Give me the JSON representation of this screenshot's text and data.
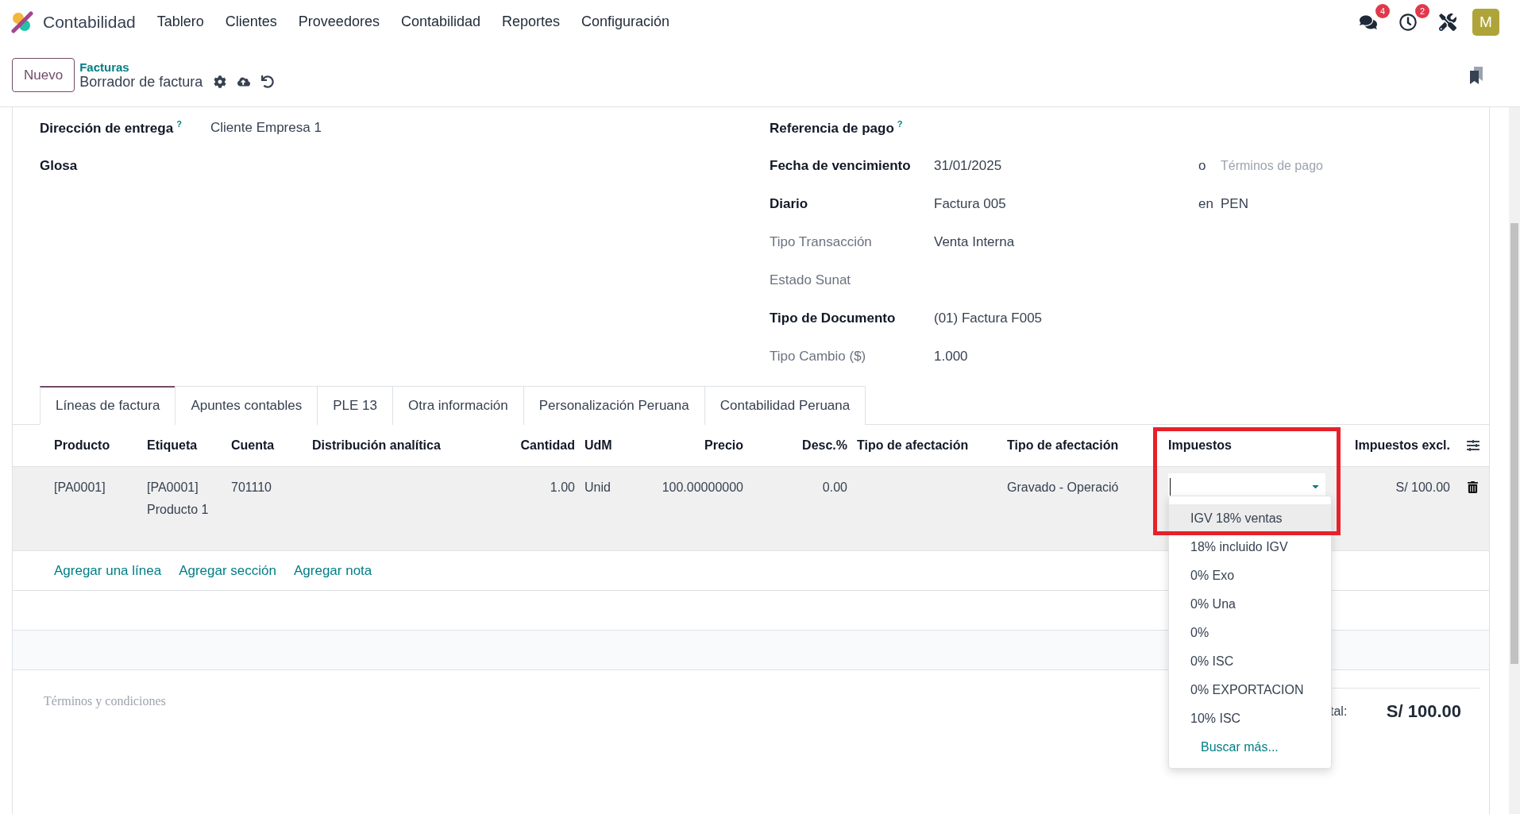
{
  "navbar": {
    "app_name": "Contabilidad",
    "menu": [
      {
        "label": "Tablero"
      },
      {
        "label": "Clientes"
      },
      {
        "label": "Proveedores"
      },
      {
        "label": "Contabilidad"
      },
      {
        "label": "Reportes"
      },
      {
        "label": "Configuración"
      }
    ],
    "messages_badge": "4",
    "activities_badge": "2",
    "avatar": "M"
  },
  "control_panel": {
    "new_button": "Nuevo",
    "breadcrumb": "Facturas",
    "record_title": "Borrador de factura"
  },
  "form": {
    "left_fields": [
      {
        "label": "Dirección de entrega",
        "help": "?",
        "emphasis": true,
        "value": "Cliente Empresa 1"
      },
      {
        "label": "Glosa",
        "emphasis": true
      }
    ],
    "right_fields": [
      {
        "label": "Referencia de pago",
        "help": "?",
        "emphasis": true
      },
      {
        "label": "Fecha de vencimiento",
        "emphasis": true,
        "value": "31/01/2025",
        "extra": {
          "connector": "o",
          "placeholder": "Términos de pago"
        }
      },
      {
        "label": "Diario",
        "emphasis": true,
        "value": "Factura 005",
        "extra": {
          "connector": "en",
          "value": "PEN"
        }
      },
      {
        "label": "Tipo Transacción",
        "emphasis": false,
        "value": "Venta Interna"
      },
      {
        "label": "Estado Sunat",
        "emphasis": false
      },
      {
        "label": "Tipo de Documento",
        "emphasis": true,
        "value": "(01) Factura F005"
      },
      {
        "label": "Tipo Cambio ($)",
        "emphasis": false,
        "value": "1.000"
      }
    ]
  },
  "tabs": [
    {
      "label": "Líneas de factura",
      "selected": true
    },
    {
      "label": "Apuntes contables",
      "selected": false
    },
    {
      "label": "PLE 13",
      "selected": false
    },
    {
      "label": "Otra información",
      "selected": false
    },
    {
      "label": "Personalización Peruana",
      "selected": false
    },
    {
      "label": "Contabilidad Peruana",
      "selected": false
    }
  ],
  "table": {
    "columns": [
      {
        "label": "Producto",
        "numeric": false
      },
      {
        "label": "Etiqueta",
        "numeric": false
      },
      {
        "label": "Cuenta",
        "numeric": false
      },
      {
        "label": "Distribución analítica",
        "numeric": false
      },
      {
        "label": "Cantidad",
        "numeric": true
      },
      {
        "label": "UdM",
        "numeric": false
      },
      {
        "label": "Precio",
        "numeric": true
      },
      {
        "label": "Desc.%",
        "numeric": true
      },
      {
        "label": "Tipo de afectación",
        "numeric": false
      },
      {
        "label": "Tipo de afectación",
        "numeric": false
      },
      {
        "label": "Impuestos",
        "numeric": false
      },
      {
        "label": "Impuestos excl.",
        "numeric": true
      }
    ],
    "rows": [
      {
        "cells": [
          {
            "kind": "text",
            "text": "[PA0001]"
          },
          {
            "kind": "text",
            "text": "[PA0001] Producto 1"
          },
          {
            "kind": "text",
            "text": "701110"
          },
          {
            "kind": "empty"
          },
          {
            "kind": "text",
            "text": "1.00"
          },
          {
            "kind": "text",
            "text": "Unid"
          },
          {
            "kind": "text",
            "text": "100.00000000"
          },
          {
            "kind": "text",
            "text": "0.00"
          },
          {
            "kind": "empty"
          },
          {
            "kind": "text",
            "text": "Gravado - Operació"
          },
          {
            "kind": "select"
          },
          {
            "kind": "text",
            "text": "S/ 100.00"
          }
        ]
      }
    ],
    "tax_dropdown": {
      "options": [
        {
          "label": "IGV 18% ventas",
          "selected": true
        },
        {
          "label": "18% incluido IGV",
          "selected": false
        },
        {
          "label": "0% Exo",
          "selected": false
        },
        {
          "label": "0% Una",
          "selected": false
        },
        {
          "label": "0%",
          "selected": false
        },
        {
          "label": "0% ISC",
          "selected": false
        },
        {
          "label": "0% EXPORTACION",
          "selected": false
        },
        {
          "label": "10% ISC",
          "selected": false
        }
      ],
      "search_more": "Buscar más..."
    },
    "add_links": [
      "Agregar una línea",
      "Agregar sección",
      "Agregar nota"
    ]
  },
  "footer": {
    "terms_placeholder": "Términos y condiciones",
    "total_label": "tal:",
    "total_value": "S/ 100.00"
  }
}
